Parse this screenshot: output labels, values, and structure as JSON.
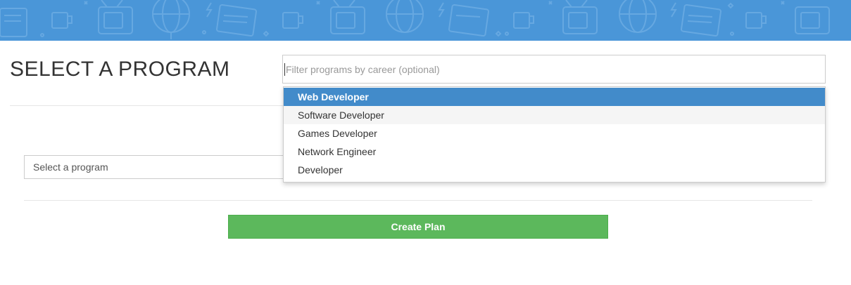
{
  "header": {
    "banner_color": "#4a96d8",
    "pattern_icons": [
      "tv-icon",
      "mug-icon",
      "globe-icon",
      "newspaper-icon",
      "lightning-icon",
      "star-icon"
    ]
  },
  "page": {
    "title": "SELECT A PROGRAM"
  },
  "career_filter": {
    "value": "",
    "placeholder": "Filter programs by career (optional)"
  },
  "career_dropdown": {
    "items": [
      {
        "label": "Web Developer",
        "state": "selected"
      },
      {
        "label": "Software Developer",
        "state": "hover"
      },
      {
        "label": "Games Developer",
        "state": "normal"
      },
      {
        "label": "Network Engineer",
        "state": "normal"
      },
      {
        "label": "Developer",
        "state": "normal"
      }
    ],
    "selected_color": "#428bca"
  },
  "program_select": {
    "placeholder": "Select a program"
  },
  "actions": {
    "create_label": "Create Plan",
    "create_color": "#5cb85c"
  }
}
